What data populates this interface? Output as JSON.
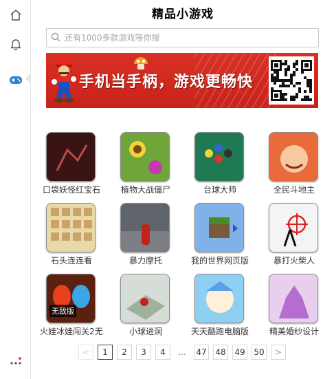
{
  "app": {
    "title": "精品小游戏"
  },
  "sidebar": {
    "items": [
      {
        "icon": "home-icon"
      },
      {
        "icon": "bell-icon"
      },
      {
        "icon": "gamepad-icon",
        "active": true
      },
      {
        "icon": "more-icon"
      }
    ]
  },
  "search": {
    "placeholder": "还有1000多款游戏等你搜",
    "value": ""
  },
  "banner": {
    "text": "手机当手柄，游戏更畅快"
  },
  "games": [
    {
      "name": "口袋妖怪红宝石",
      "color": "#6b2a2a"
    },
    {
      "name": "植物大战僵尸",
      "color": "#5a8c2b"
    },
    {
      "name": "台球大师",
      "color": "#1d6a4b"
    },
    {
      "name": "全民斗地主",
      "color": "#d9542a"
    },
    {
      "name": "石头连连看",
      "color": "#c8a86a"
    },
    {
      "name": "暴力摩托",
      "color": "#555a60"
    },
    {
      "name": "我的世界网页版",
      "color": "#6e9bd4"
    },
    {
      "name": "暴打火柴人",
      "color": "#f2f2f2"
    },
    {
      "name": "火娃冰娃闯关2无",
      "color": "#b23a1b",
      "badge": "无敌版"
    },
    {
      "name": "小球进洞",
      "color": "#b8c4b8"
    },
    {
      "name": "天天酷跑电脑版",
      "color": "#4aa0d8"
    },
    {
      "name": "精美婚纱设计",
      "color": "#c9a3d8"
    }
  ],
  "pagination": {
    "prev": "<",
    "next": ">",
    "pages": [
      "1",
      "2",
      "3",
      "4"
    ],
    "ellipsis": "…",
    "tail": [
      "47",
      "48",
      "49",
      "50"
    ],
    "current": "1"
  }
}
